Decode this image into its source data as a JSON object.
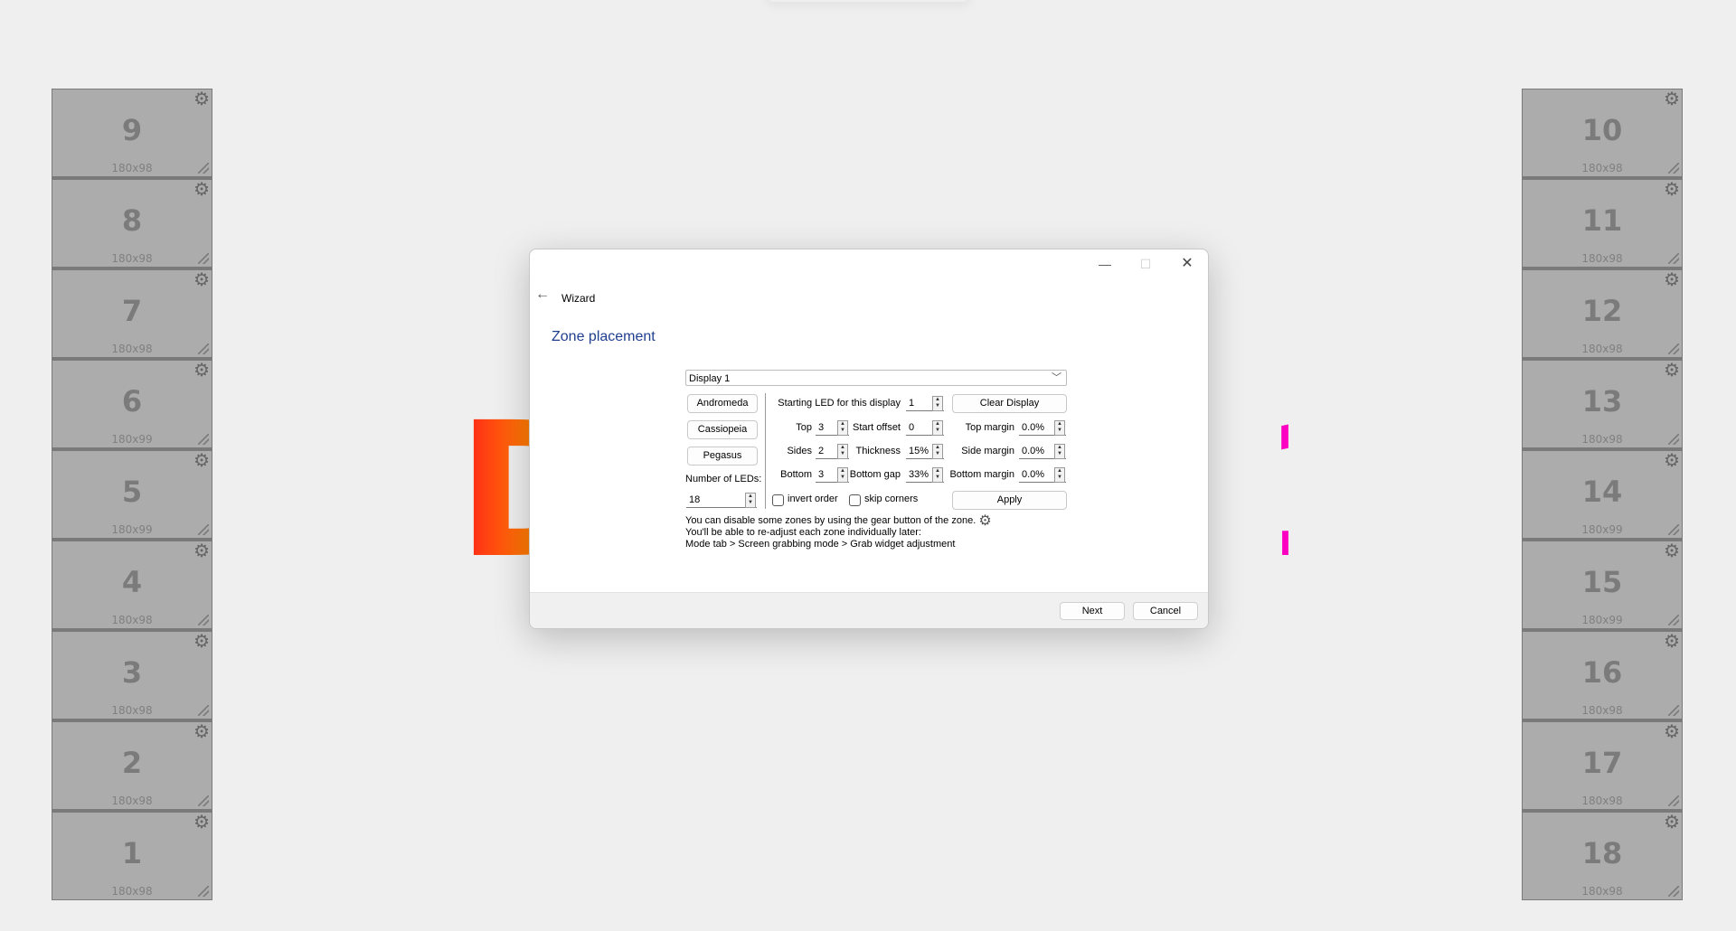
{
  "background": {
    "big_text": "Display 1"
  },
  "zones_left": [
    {
      "num": "9",
      "size": "180x98"
    },
    {
      "num": "8",
      "size": "180x98"
    },
    {
      "num": "7",
      "size": "180x98"
    },
    {
      "num": "6",
      "size": "180x99"
    },
    {
      "num": "5",
      "size": "180x99"
    },
    {
      "num": "4",
      "size": "180x98"
    },
    {
      "num": "3",
      "size": "180x98"
    },
    {
      "num": "2",
      "size": "180x98"
    },
    {
      "num": "1",
      "size": "180x98"
    }
  ],
  "zones_right": [
    {
      "num": "10",
      "size": "180x98"
    },
    {
      "num": "11",
      "size": "180x98"
    },
    {
      "num": "12",
      "size": "180x98"
    },
    {
      "num": "13",
      "size": "180x98"
    },
    {
      "num": "14",
      "size": "180x99"
    },
    {
      "num": "15",
      "size": "180x99"
    },
    {
      "num": "16",
      "size": "180x98"
    },
    {
      "num": "17",
      "size": "180x98"
    },
    {
      "num": "18",
      "size": "180x98"
    }
  ],
  "icons": {
    "gear": "⚙",
    "back": "←",
    "minimize": "—",
    "maximize": "☐",
    "close": "✕",
    "chevron_down": "﹀",
    "spin": "▲\n▼"
  },
  "dialog": {
    "window_title": "Wizard",
    "page_title": "Zone placement",
    "display_select": "Display 1",
    "presets": [
      "Andromeda",
      "Cassiopeia",
      "Pegasus"
    ],
    "num_leds_label": "Number of LEDs:",
    "num_leds_value": "18",
    "starting_led_label": "Starting LED for this display",
    "starting_led_value": "1",
    "clear_display": "Clear Display",
    "top_label": "Top",
    "top_value": "3",
    "sides_label": "Sides",
    "sides_value": "2",
    "bottom_label": "Bottom",
    "bottom_value": "3",
    "start_offset_label": "Start offset",
    "start_offset_value": "0",
    "thickness_label": "Thickness",
    "thickness_value": "15%",
    "bottom_gap_label": "Bottom gap",
    "bottom_gap_value": "33%",
    "top_margin_label": "Top margin",
    "top_margin_value": "0.0%",
    "side_margin_label": "Side margin",
    "side_margin_value": "0.0%",
    "bottom_margin_label": "Bottom margin",
    "bottom_margin_value": "0.0%",
    "invert_order_label": "invert order",
    "invert_order_checked": false,
    "skip_corners_label": "skip corners",
    "skip_corners_checked": false,
    "apply": "Apply",
    "info_line1": "You can disable some zones by using the gear button of the zone.",
    "info_line2": "You'll be able to re-adjust each zone individually later:",
    "info_line3": "Mode tab > Screen grabbing mode > Grab widget adjustment",
    "next": "Next",
    "cancel": "Cancel"
  }
}
